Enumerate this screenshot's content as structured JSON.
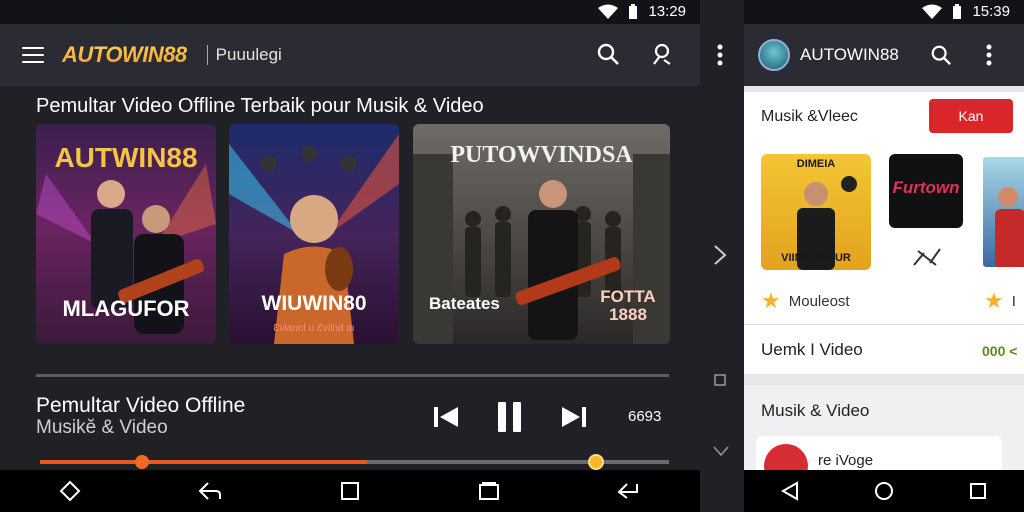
{
  "left": {
    "status_time": "13:29",
    "logo": "AUTOWIN88",
    "appbar_subtitle": "Puuulegi",
    "section_title": "Pemultar Video Offline Terbaik pour Musik & Video",
    "cards": [
      {
        "title": "AUTWIN88",
        "label": "MLAGUFOR"
      },
      {
        "title": "",
        "label": "WIUWIN80",
        "sublabel": "Ɛvianol ʊ Ɛvilnd ɑı"
      },
      {
        "title": "PUTOWVINDSA",
        "label": "Bateates",
        "badge": "FOTTA 1888"
      }
    ],
    "now_playing_title": "Pemultar Video Offline",
    "now_playing_sub": "Musikĕ & Video",
    "time": "6693",
    "progress": 0.52
  },
  "right": {
    "status_time": "15:39",
    "title": "AUTOWIN88",
    "section_title": "Musik &Vleec",
    "button_label": "Kan",
    "tiles": [
      {
        "title": "DIMEIA",
        "label": "VIINE 3BUUR"
      },
      {
        "title": "Furtown"
      },
      {
        "title": ""
      }
    ],
    "ratings": [
      "Mouleost",
      "I"
    ],
    "row2_label": "Uemk I Video",
    "row2_dots": "000 <",
    "section2_title": "Musik & Video",
    "item_label": "re iVoge"
  }
}
